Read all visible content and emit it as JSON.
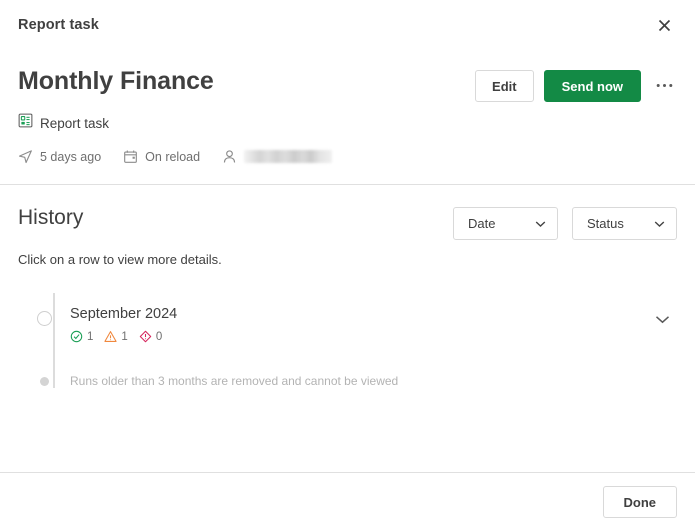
{
  "window": {
    "panel_title": "Report task",
    "close_icon": "close-icon"
  },
  "header": {
    "title": "Monthly Finance",
    "subtitle": "Report task",
    "subtitle_icon": "report-task-icon",
    "accent_color": "#138a45",
    "actions": {
      "edit_label": "Edit",
      "send_now_label": "Send now",
      "more_label": "•••"
    },
    "meta": [
      {
        "icon": "send-icon",
        "label": "5 days ago"
      },
      {
        "icon": "calendar-icon",
        "label": "On reload"
      },
      {
        "icon": "person-icon",
        "label": "",
        "redacted": true
      }
    ]
  },
  "history": {
    "title": "History",
    "hint": "Click on a row to view more details.",
    "filters": [
      {
        "label": "Date",
        "icon": "chevron-down-icon"
      },
      {
        "label": "Status",
        "icon": "chevron-down-icon"
      }
    ],
    "entries": [
      {
        "period": "September 2024",
        "expand_icon": "chevron-down-icon",
        "counts": [
          {
            "status": "success",
            "icon": "check-circle-icon",
            "value": "1",
            "color": "#1a9e55"
          },
          {
            "status": "warning",
            "icon": "warning-triangle-icon",
            "value": "1",
            "color": "#f0883e"
          },
          {
            "status": "error",
            "icon": "error-diamond-icon",
            "value": "0",
            "color": "#d6275e"
          }
        ]
      }
    ],
    "retention_note": "Runs older than 3 months are removed and cannot be viewed"
  },
  "footer": {
    "done_label": "Done"
  }
}
